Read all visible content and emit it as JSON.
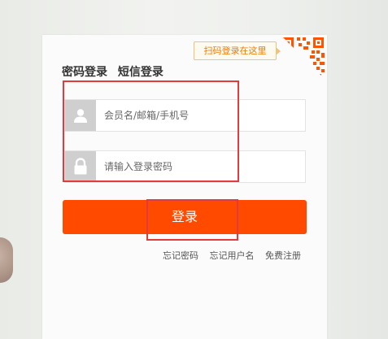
{
  "qr_hint": {
    "text": "扫码登录在这里"
  },
  "tabs": [
    {
      "label": "密码登录"
    },
    {
      "label": "短信登录"
    }
  ],
  "username": {
    "placeholder": "会员名/邮箱/手机号",
    "value": "",
    "icon": "user-icon"
  },
  "password": {
    "placeholder": "请输入登录密码",
    "value": "",
    "icon": "lock-icon"
  },
  "login_button": {
    "label": "登录"
  },
  "links": [
    {
      "label": "忘记密码"
    },
    {
      "label": "忘记用户名"
    },
    {
      "label": "免费注册"
    }
  ],
  "colors": {
    "accent": "#ff4a00",
    "highlight_box": "#e23b3b",
    "qr_hint_text": "#f07a00"
  }
}
